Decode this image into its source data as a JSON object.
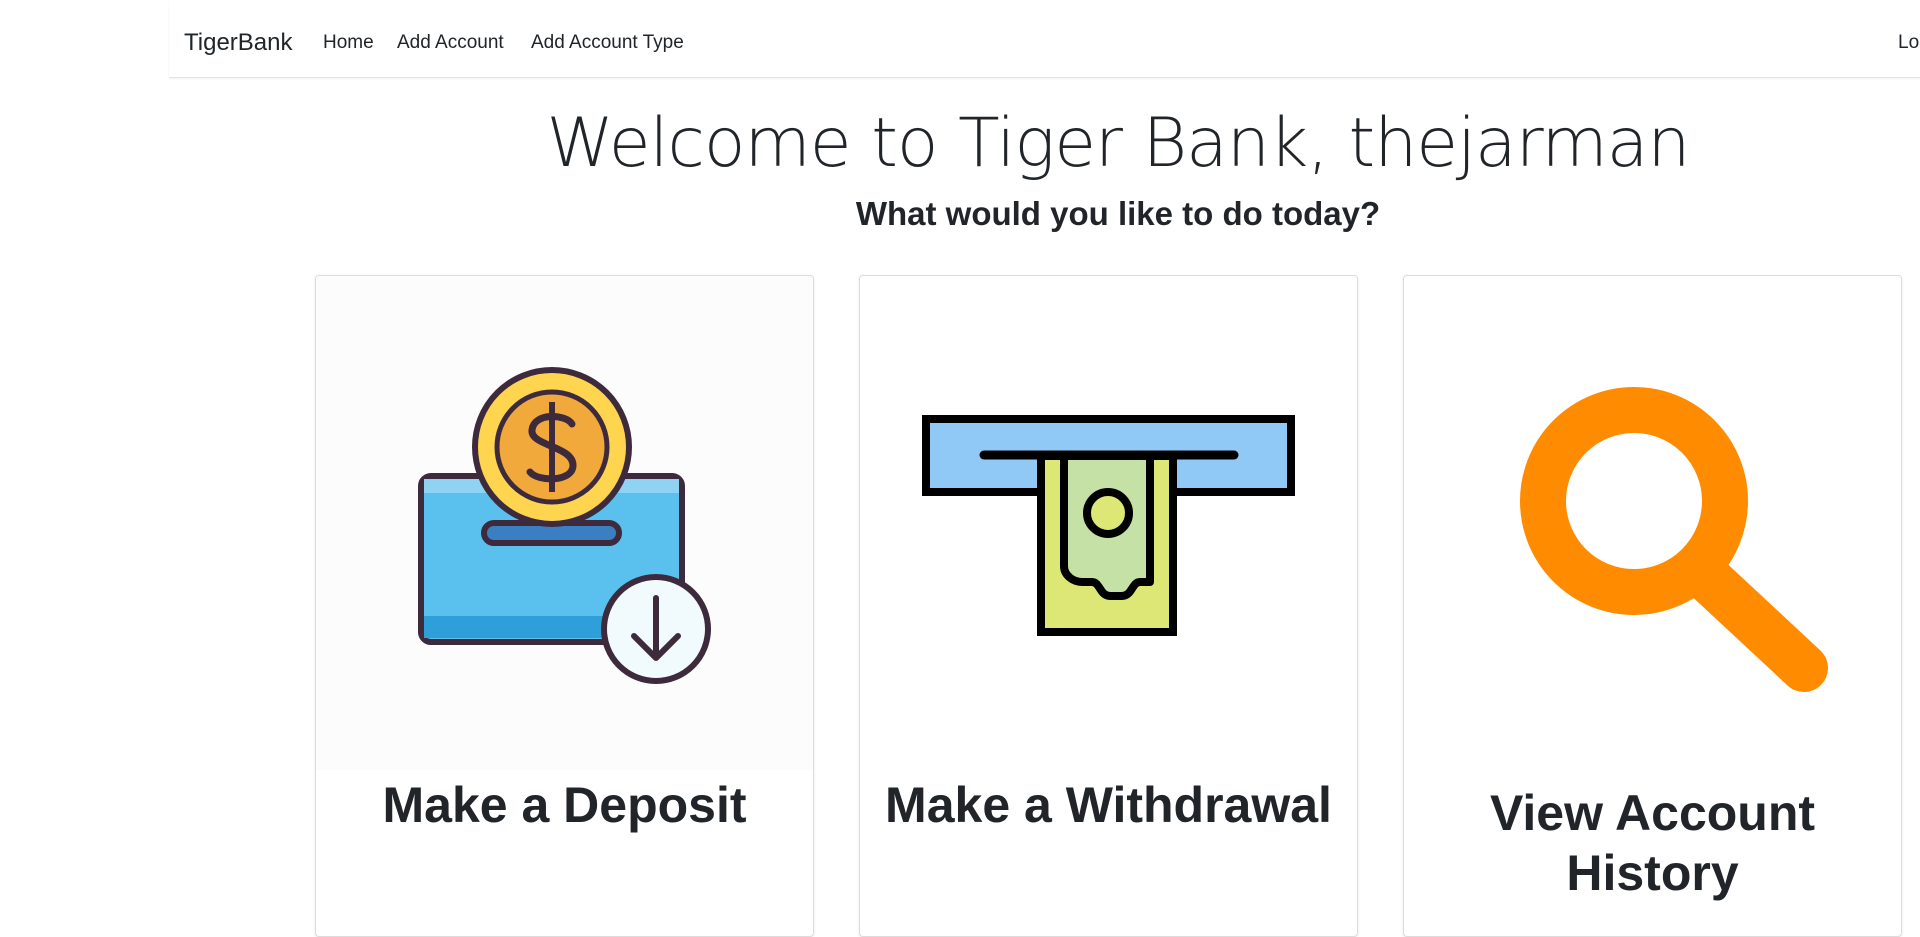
{
  "navbar": {
    "brand": "TigerBank",
    "links": [
      "Home",
      "Add Account",
      "Add Account Type"
    ],
    "logout_partial": "Lo"
  },
  "hero": {
    "welcome": "Welcome to Tiger Bank, thejarman",
    "subtitle": "What would you like to do today?"
  },
  "cards": [
    {
      "title": "Make a Deposit",
      "icon": "deposit-coin-icon"
    },
    {
      "title": "Make a Withdrawal",
      "icon": "atm-cash-icon"
    },
    {
      "title": "View Account History",
      "icon": "magnifier-icon"
    }
  ],
  "colors": {
    "coin_gold": "#F2A93B",
    "box_blue": "#5AC1EE",
    "slot_blue": "#91C9F6",
    "cash_green": "#DCE775",
    "magnifier_orange": "#FF8C00",
    "outline": "#3D2B3D"
  }
}
